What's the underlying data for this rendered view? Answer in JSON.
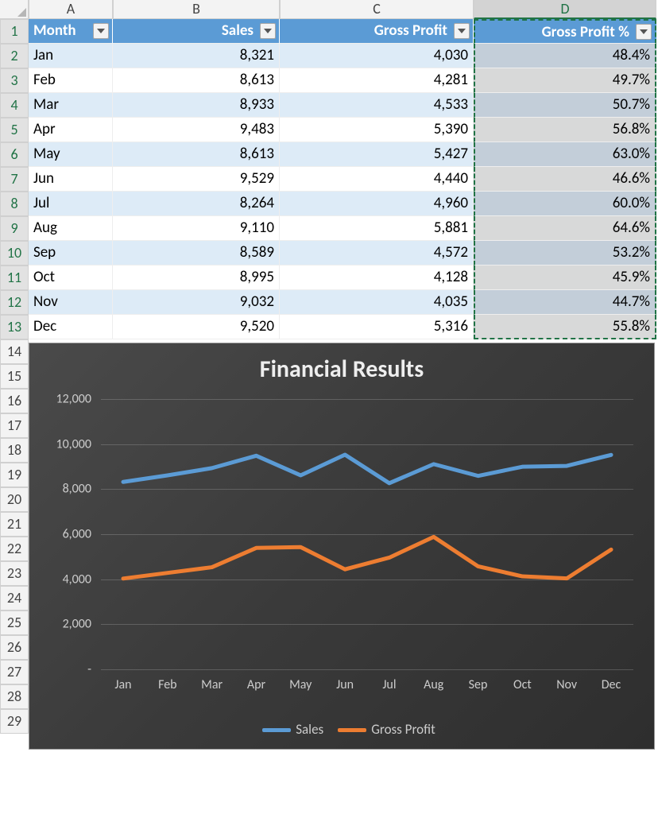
{
  "columns": [
    "A",
    "B",
    "C",
    "D"
  ],
  "headers": {
    "month": "Month",
    "sales": "Sales",
    "gross_profit": "Gross Profit",
    "gross_profit_pct": "Gross Profit %"
  },
  "rows": [
    {
      "n": 1
    },
    {
      "n": 2,
      "month": "Jan",
      "sales": "8,321",
      "gp": "4,030",
      "pct": "48.4%"
    },
    {
      "n": 3,
      "month": "Feb",
      "sales": "8,613",
      "gp": "4,281",
      "pct": "49.7%"
    },
    {
      "n": 4,
      "month": "Mar",
      "sales": "8,933",
      "gp": "4,533",
      "pct": "50.7%"
    },
    {
      "n": 5,
      "month": "Apr",
      "sales": "9,483",
      "gp": "5,390",
      "pct": "56.8%"
    },
    {
      "n": 6,
      "month": "May",
      "sales": "8,613",
      "gp": "5,427",
      "pct": "63.0%"
    },
    {
      "n": 7,
      "month": "Jun",
      "sales": "9,529",
      "gp": "4,440",
      "pct": "46.6%"
    },
    {
      "n": 8,
      "month": "Jul",
      "sales": "8,264",
      "gp": "4,960",
      "pct": "60.0%"
    },
    {
      "n": 9,
      "month": "Aug",
      "sales": "9,110",
      "gp": "5,881",
      "pct": "64.6%"
    },
    {
      "n": 10,
      "month": "Sep",
      "sales": "8,589",
      "gp": "4,572",
      "pct": "53.2%"
    },
    {
      "n": 11,
      "month": "Oct",
      "sales": "8,995",
      "gp": "4,128",
      "pct": "45.9%"
    },
    {
      "n": 12,
      "month": "Nov",
      "sales": "9,032",
      "gp": "4,035",
      "pct": "44.7%"
    },
    {
      "n": 13,
      "month": "Dec",
      "sales": "9,520",
      "gp": "5,316",
      "pct": "55.8%"
    }
  ],
  "extra_rows": [
    14,
    15,
    16,
    17,
    18,
    19,
    20,
    21,
    22,
    23,
    24,
    25,
    26,
    27,
    28,
    29
  ],
  "chart_data": {
    "type": "line",
    "title": "Financial Results",
    "categories": [
      "Jan",
      "Feb",
      "Mar",
      "Apr",
      "May",
      "Jun",
      "Jul",
      "Aug",
      "Sep",
      "Oct",
      "Nov",
      "Dec"
    ],
    "series": [
      {
        "name": "Sales",
        "color": "#5b9bd5",
        "values": [
          8321,
          8613,
          8933,
          9483,
          8613,
          9529,
          8264,
          9110,
          8589,
          8995,
          9032,
          9520
        ]
      },
      {
        "name": "Gross Profit",
        "color": "#ed7d31",
        "values": [
          4030,
          4281,
          4533,
          5390,
          5427,
          4440,
          4960,
          5881,
          4572,
          4128,
          4035,
          5316
        ]
      }
    ],
    "yticks": [
      {
        "v": 0,
        "label": "-"
      },
      {
        "v": 2000,
        "label": "2,000"
      },
      {
        "v": 4000,
        "label": "4,000"
      },
      {
        "v": 6000,
        "label": "6,000"
      },
      {
        "v": 8000,
        "label": "8,000"
      },
      {
        "v": 10000,
        "label": "10,000"
      },
      {
        "v": 12000,
        "label": "12,000"
      }
    ],
    "ylim": [
      0,
      12000
    ]
  }
}
